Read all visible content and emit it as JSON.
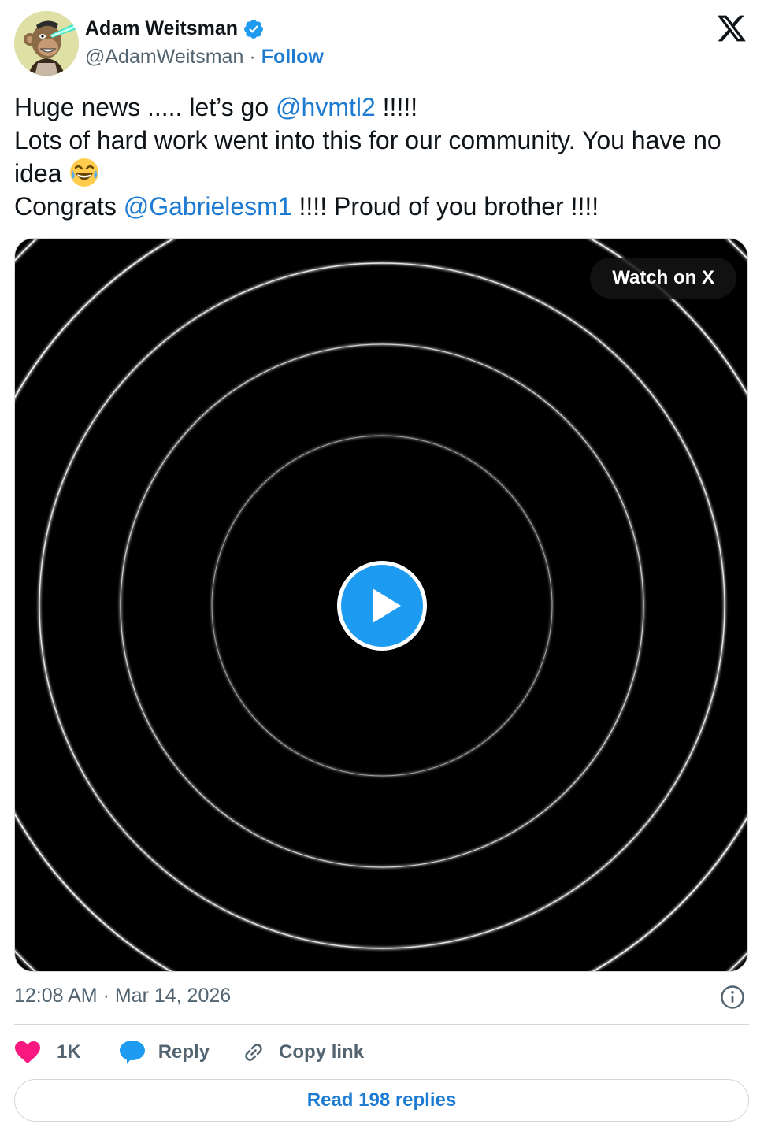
{
  "author": {
    "name": "Adam Weitsman",
    "handle": "@AdamWeitsman",
    "separator": "·",
    "follow_label": "Follow"
  },
  "tweet": {
    "line1_pre": "Huge news .....  let’s go ",
    "line1_mention": "@hvmtl2",
    "line1_post": " !!!!!",
    "line2": "Lots of hard work went into this for our community. You have no idea",
    "line3_pre": "Congrats ",
    "line3_mention": "@Gabrielesm1",
    "line3_post": " !!!! Proud of you brother !!!!"
  },
  "media": {
    "watch_label": "Watch on X"
  },
  "meta": {
    "timestamp": "12:08 AM · Mar 14, 2026"
  },
  "actions": {
    "like_count": "1K",
    "reply_label": "Reply",
    "copy_label": "Copy link"
  },
  "read_replies_label": "Read 198 replies",
  "colors": {
    "link": "#1d7bd2",
    "text": "#0f1419",
    "muted": "#536471",
    "like": "#f91880",
    "border": "#cfd9de"
  }
}
